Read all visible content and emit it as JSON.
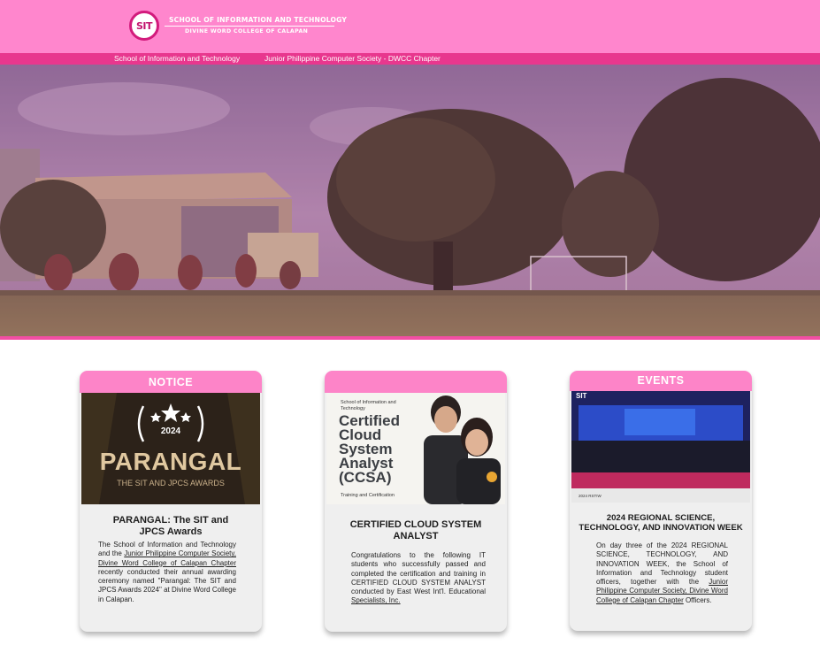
{
  "header": {
    "logo_text": "SIT",
    "school_name": "SCHOOL OF INFORMATION AND TECHNOLOGY",
    "college_name": "DIVINE WORD COLLEGE OF CALAPAN"
  },
  "nav": {
    "items": [
      {
        "label": "School of Information and Technology"
      },
      {
        "label": "Junior Philippine Computer Society - DWCC Chapter"
      }
    ]
  },
  "colors": {
    "header_pink": "#ff86cd",
    "nav_pink": "#e8378e",
    "card_header_pink": "#fd84c8",
    "card_bg": "#efefef"
  },
  "cards": [
    {
      "header": "NOTICE",
      "image": {
        "year": "2024",
        "headline": "PARANGAL",
        "subline": "THE SIT AND JPCS AWARDS"
      },
      "title": "PARANGAL: The SIT and JPCS Awards",
      "body_before_link": "The School of Information and Technology and the ",
      "body_link": "Junior Philippine Computer Society, Divine Word College of Calapan Chapter",
      "body_after_link": " recently conducted their annual awarding ceremony named \"Parangal: The SIT and JPCS Awards 2024\" at Divine Word College in Calapan."
    },
    {
      "header": "",
      "image": {
        "caption_small": "School of Information and Technology",
        "headline_lines": [
          "Certified",
          "Cloud",
          "System",
          "Analyst",
          "(CCSA)"
        ],
        "footer": "Training and Certification"
      },
      "title": "CERTIFIED CLOUD SYSTEM ANALYST",
      "body_before_link": "Congratulations to the following IT students who successfully passed and completed the certification and training in CERTIFIED CLOUD SYSTEM ANALYST conducted by East West Int'l. Educational",
      "body_link": " Specialists, Inc.",
      "body_after_link": ""
    },
    {
      "header": "EVENTS",
      "image": {
        "logo": "SIT",
        "corner_text": "2024 RSTIW"
      },
      "title": "2024 REGIONAL SCIENCE, TECHNOLOGY, AND INNOVATION WEEK",
      "body_before_link": "On day three of the 2024 REGIONAL SCIENCE, TECHNOLOGY, AND INNOVATION WEEK, the School of Information and Technology student officers, together with the ",
      "body_link": "Junior Philippine Computer Society, Divine Word College of Calapan Chapter",
      "body_after_link": " Officers."
    }
  ]
}
